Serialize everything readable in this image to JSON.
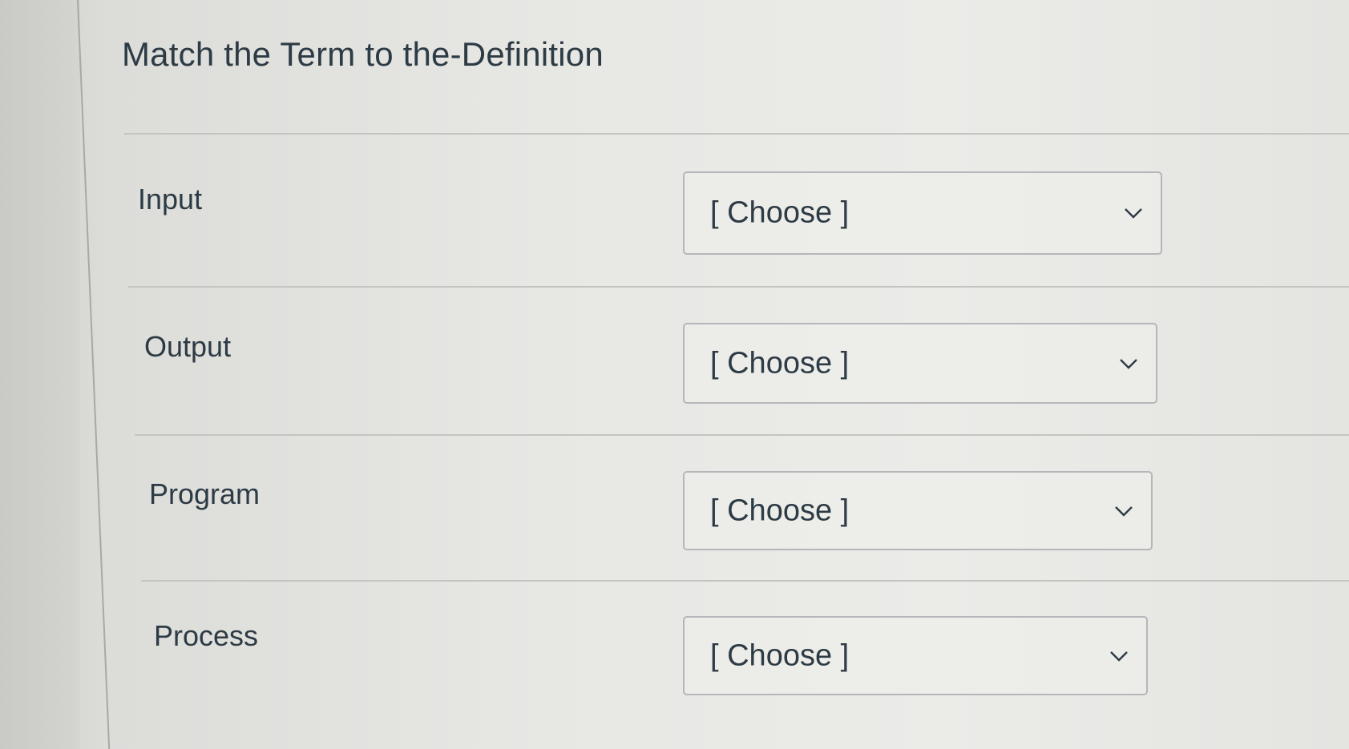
{
  "quiz": {
    "title": "Match the Term to the-Definition",
    "rows": [
      {
        "term": "Input",
        "selected": "[ Choose ]"
      },
      {
        "term": "Output",
        "selected": "[ Choose ]"
      },
      {
        "term": "Program",
        "selected": "[ Choose ]"
      },
      {
        "term": "Process",
        "selected": "[ Choose ]"
      }
    ]
  },
  "icons": {
    "dropdown": "chevron-down-icon"
  },
  "colors": {
    "text": "#2d3b45",
    "border": "#b4b7ba",
    "divider": "#c4c4c1"
  }
}
